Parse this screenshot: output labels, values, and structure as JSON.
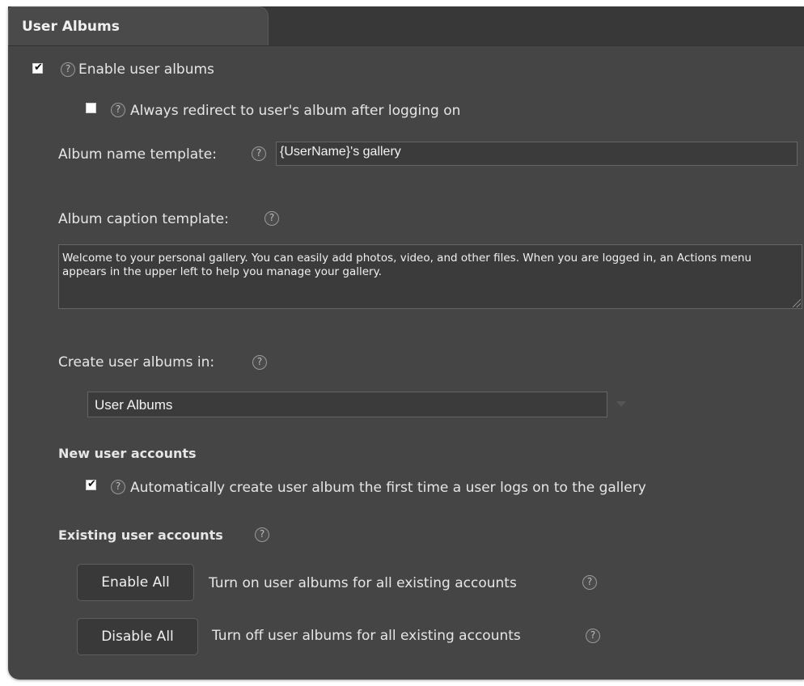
{
  "section": {
    "title": "User Albums"
  },
  "settings": {
    "enable_user_albums": {
      "label": "Enable user albums",
      "checked": true
    },
    "redirect_after_logon": {
      "label": "Always redirect to user's album after logging on",
      "checked": false
    },
    "album_name_template": {
      "label": "Album name template:",
      "value": "{UserName}'s gallery"
    },
    "album_caption_template": {
      "label": "Album caption template:",
      "value": "Welcome to your personal gallery. You can easily add photos, video, and other files. When you are logged in, an Actions menu appears in the upper left to help you manage your gallery."
    },
    "create_albums_in": {
      "label": "Create user albums in:",
      "selected": "User Albums"
    }
  },
  "new_user_accounts": {
    "heading": "New user accounts",
    "auto_create": {
      "label": "Automatically create user album the first time a user logs on to the gallery",
      "checked": true
    }
  },
  "existing_user_accounts": {
    "heading": "Existing user accounts",
    "enable_all": {
      "button": "Enable All",
      "description": "Turn on user albums for all existing accounts"
    },
    "disable_all": {
      "button": "Disable All",
      "description": "Turn off user albums for all existing accounts"
    }
  },
  "icons": {
    "help": "help-icon",
    "check": "checkmark-icon"
  },
  "colors": {
    "panel_bg": "#454545",
    "header_bg": "#383838",
    "input_bg": "#3b3b3b",
    "text": "#e6e6e6"
  }
}
